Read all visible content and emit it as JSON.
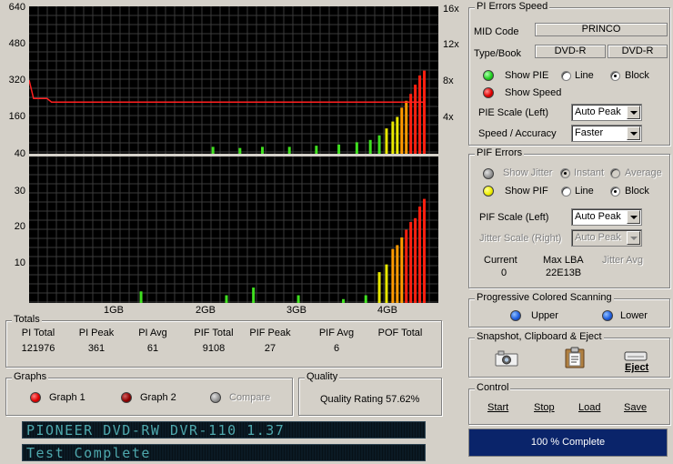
{
  "top_graph": {
    "y_left_ticks": [
      "640",
      "480",
      "320",
      "160",
      "40"
    ],
    "y_right_ticks": [
      "16x",
      "12x",
      "8x",
      "4x"
    ]
  },
  "bottom_graph": {
    "y_left_ticks": [
      "30",
      "20",
      "10"
    ]
  },
  "x_ticks": [
    "1GB",
    "2GB",
    "3GB",
    "4GB"
  ],
  "chart_data": [
    {
      "type": "bar",
      "series": [
        {
          "name": "PI Errors",
          "x_gb": [
            2.05,
            2.35,
            2.6,
            2.9,
            3.2,
            3.45,
            3.65,
            3.8,
            3.9,
            3.98,
            4.05,
            4.1,
            4.15,
            4.2,
            4.25,
            4.3,
            4.35,
            4.4
          ],
          "values": [
            30,
            25,
            30,
            30,
            35,
            40,
            50,
            60,
            80,
            110,
            140,
            160,
            200,
            230,
            260,
            300,
            340,
            361
          ]
        }
      ],
      "speed_series": {
        "name": "Speed",
        "x_gb": [
          0,
          0.05,
          0.2,
          0.25,
          4.0,
          4.4
        ],
        "values": [
          8,
          6,
          6,
          5.6,
          5.6,
          5.6
        ]
      },
      "ylim_left": [
        0,
        640
      ],
      "ylim_right": [
        0,
        16
      ],
      "xlim_gb": [
        0,
        4.4
      ]
    },
    {
      "type": "bar",
      "series": [
        {
          "name": "PIF",
          "x_gb": [
            1.25,
            2.2,
            2.5,
            3.0,
            3.5,
            3.75,
            3.9,
            3.98,
            4.05,
            4.1,
            4.15,
            4.2,
            4.25,
            4.3,
            4.35,
            4.4
          ],
          "values": [
            3,
            2,
            4,
            2,
            1,
            2,
            8,
            10,
            14,
            15,
            17,
            19,
            21,
            22,
            25,
            27
          ]
        }
      ],
      "ylim": [
        0,
        38
      ],
      "xlim_gb": [
        0,
        4.4
      ]
    }
  ],
  "pi_speed": {
    "title": "PI Errors  Speed",
    "mid_code_label": "MID Code",
    "mid_code": "PRINCO",
    "typebook_label": "Type/Book",
    "type": "DVD-R",
    "book": "DVD-R",
    "show_pie": "Show PIE",
    "show_speed": "Show Speed",
    "line": "Line",
    "block": "Block",
    "pie_scale_label": "PIE Scale (Left)",
    "pie_scale_value": "Auto Peak",
    "speed_acc_label": "Speed / Accuracy",
    "speed_acc_value": "Faster"
  },
  "pif": {
    "title": "PIF Errors",
    "show_jitter": "Show Jitter",
    "instant": "Instant",
    "average": "Average",
    "show_pif": "Show PIF",
    "line": "Line",
    "block": "Block",
    "pif_scale_label": "PIF Scale (Left)",
    "pif_scale_value": "Auto Peak",
    "jitter_scale_label": "Jitter Scale (Right)",
    "jitter_scale_value": "Auto Peak",
    "current_label": "Current",
    "current_value": "0",
    "maxlba_label": "Max LBA",
    "maxlba_value": "22E13B",
    "jitter_avg_label": "Jitter Avg"
  },
  "progressive": {
    "title": "Progressive Colored Scanning",
    "upper": "Upper",
    "lower": "Lower"
  },
  "snapshot": {
    "title": "Snapshot,  Clipboard  & Eject",
    "eject": "Eject"
  },
  "control": {
    "title": "Control",
    "start": "Start",
    "stop": "Stop",
    "load": "Load",
    "save": "Save"
  },
  "status": {
    "progress_text": "100 % Complete",
    "progress_fraction": 1.0
  },
  "totals": {
    "title": "Totals",
    "headers": [
      "PI Total",
      "PI Peak",
      "PI Avg",
      "PIF Total",
      "PIF Peak",
      "PIF Avg",
      "POF Total"
    ],
    "values": [
      "121976",
      "361",
      "61",
      "9108",
      "27",
      "6",
      ""
    ]
  },
  "graphs": {
    "title": "Graphs",
    "graph1": "Graph 1",
    "graph2": "Graph 2",
    "compare": "Compare"
  },
  "quality": {
    "title": "Quality",
    "rating": "Quality Rating 57.62%"
  },
  "lcd": {
    "drive": "PIONEER DVD-RW  DVR-110 1.37",
    "status": "Test Complete"
  },
  "colors": {
    "plot_bg": "#000000",
    "grid": "#3a3a3a",
    "speed": "#ff2020",
    "progress": "#0a246a"
  }
}
